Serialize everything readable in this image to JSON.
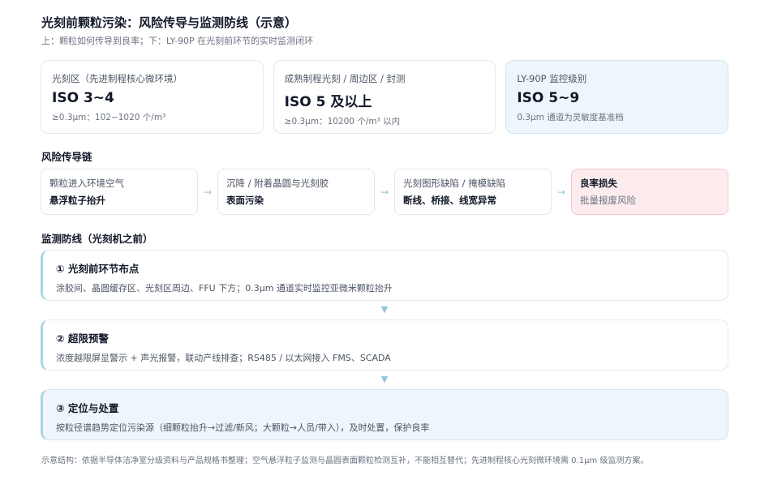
{
  "header": {
    "title": "光刻前颗粒污染：风险传导与监测防线（示意）",
    "subtitle": "上：颗粒如何传导到良率；下：LY-90P 在光刻前环节的实时监测闭环"
  },
  "zones": [
    {
      "label": "光刻区（先进制程核心微环境）",
      "value": "ISO 3~4",
      "note": "≥0.3μm：102~1020 个/m³"
    },
    {
      "label": "成熟制程光刻 / 周边区 / 封测",
      "value": "ISO 5 及以上",
      "note": "≥0.3μm：10200 个/m³ 以内"
    },
    {
      "label": "LY-90P 监控级别",
      "value": "ISO 5~9",
      "note": "0.3μm 通道为灵敏度基准档"
    }
  ],
  "chain_section": {
    "title": "风险传导链"
  },
  "chain": [
    {
      "top": "颗粒进入环境空气",
      "bottom": "悬浮粒子抬升"
    },
    {
      "top": "沉降 / 附着晶圆与光刻胶",
      "bottom": "表面污染"
    },
    {
      "top": "光刻图形缺陷 / 掩模缺陷",
      "bottom": "断线、桥接、线宽异常"
    },
    {
      "top": "良率损失",
      "bottom": "批量报废风险"
    }
  ],
  "arrow_glyph": "→",
  "down_glyph": "▼",
  "defense_section": {
    "title": "监测防线（光刻机之前）"
  },
  "steps": [
    {
      "title": "① 光刻前环节布点",
      "desc": "涂胶间、晶圆缓存区、光刻区周边、FFU 下方；0.3μm 通道实时监控亚微米颗粒抬升"
    },
    {
      "title": "② 超限预警",
      "desc": "浓度越限屏显警示 + 声光报警，联动产线排查；RS485 / 以太网接入 FMS、SCADA"
    },
    {
      "title": "③ 定位与处置",
      "desc": "按粒径谱趋势定位污染源（细颗粒抬升→过滤/新风；大颗粒→人员/带入），及时处置，保护良率"
    }
  ],
  "footnote": "示意结构：依据半导体洁净室分级资料与产品规格书整理；空气悬浮粒子监测与晶圆表面颗粒检测互补，不能相互替代；先进制程核心光刻微环境需 0.1μm 级监测方案。",
  "colors": {
    "accent": "#a9d3e6",
    "highlight_bg": "#eef6fb",
    "loss_bg": "#fdecee",
    "loss_border": "#f4c4ca"
  }
}
